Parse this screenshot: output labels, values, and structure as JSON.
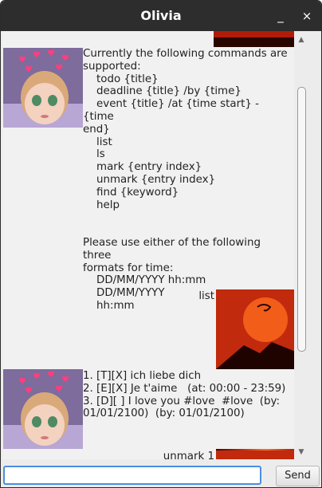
{
  "window": {
    "title": "Olivia",
    "minimize_glyph": "_",
    "close_glyph": "×"
  },
  "chat": {
    "commands_message": "Currently the following commands are\nsupported:\n    todo {title}\n    deadline {title} /by {time}\n    event {title} /at {time start} - {time\nend}\n    list\n    ls\n    mark {entry index}\n    unmark {entry index}\n    find {keyword}\n    help\n\n\nPlease use either of the following three\nformats for time:\n    DD/MM/YYYY hh:mm\n    DD/MM/YYYY\n    hh:mm",
    "user_message_1": "list",
    "list_message": "1. [T][X] ich liebe dich\n2. [E][X] Je t'aime   (at: 00:00 - 23:59)\n3. [D][ ] I love you #love  #love  (by:\n01/01/2100)  (by: 01/01/2100)",
    "user_message_2": "unmark 1"
  },
  "input": {
    "value": "",
    "placeholder": ""
  },
  "send_button": {
    "label": "Send"
  },
  "colors": {
    "titlebar": "#2d2d2d",
    "input_focus": "#4a8fe0",
    "chat_bg": "#f1f1f1"
  },
  "icons": [
    "minimize-icon",
    "close-icon",
    "scroll-up-icon",
    "scroll-down-icon"
  ]
}
